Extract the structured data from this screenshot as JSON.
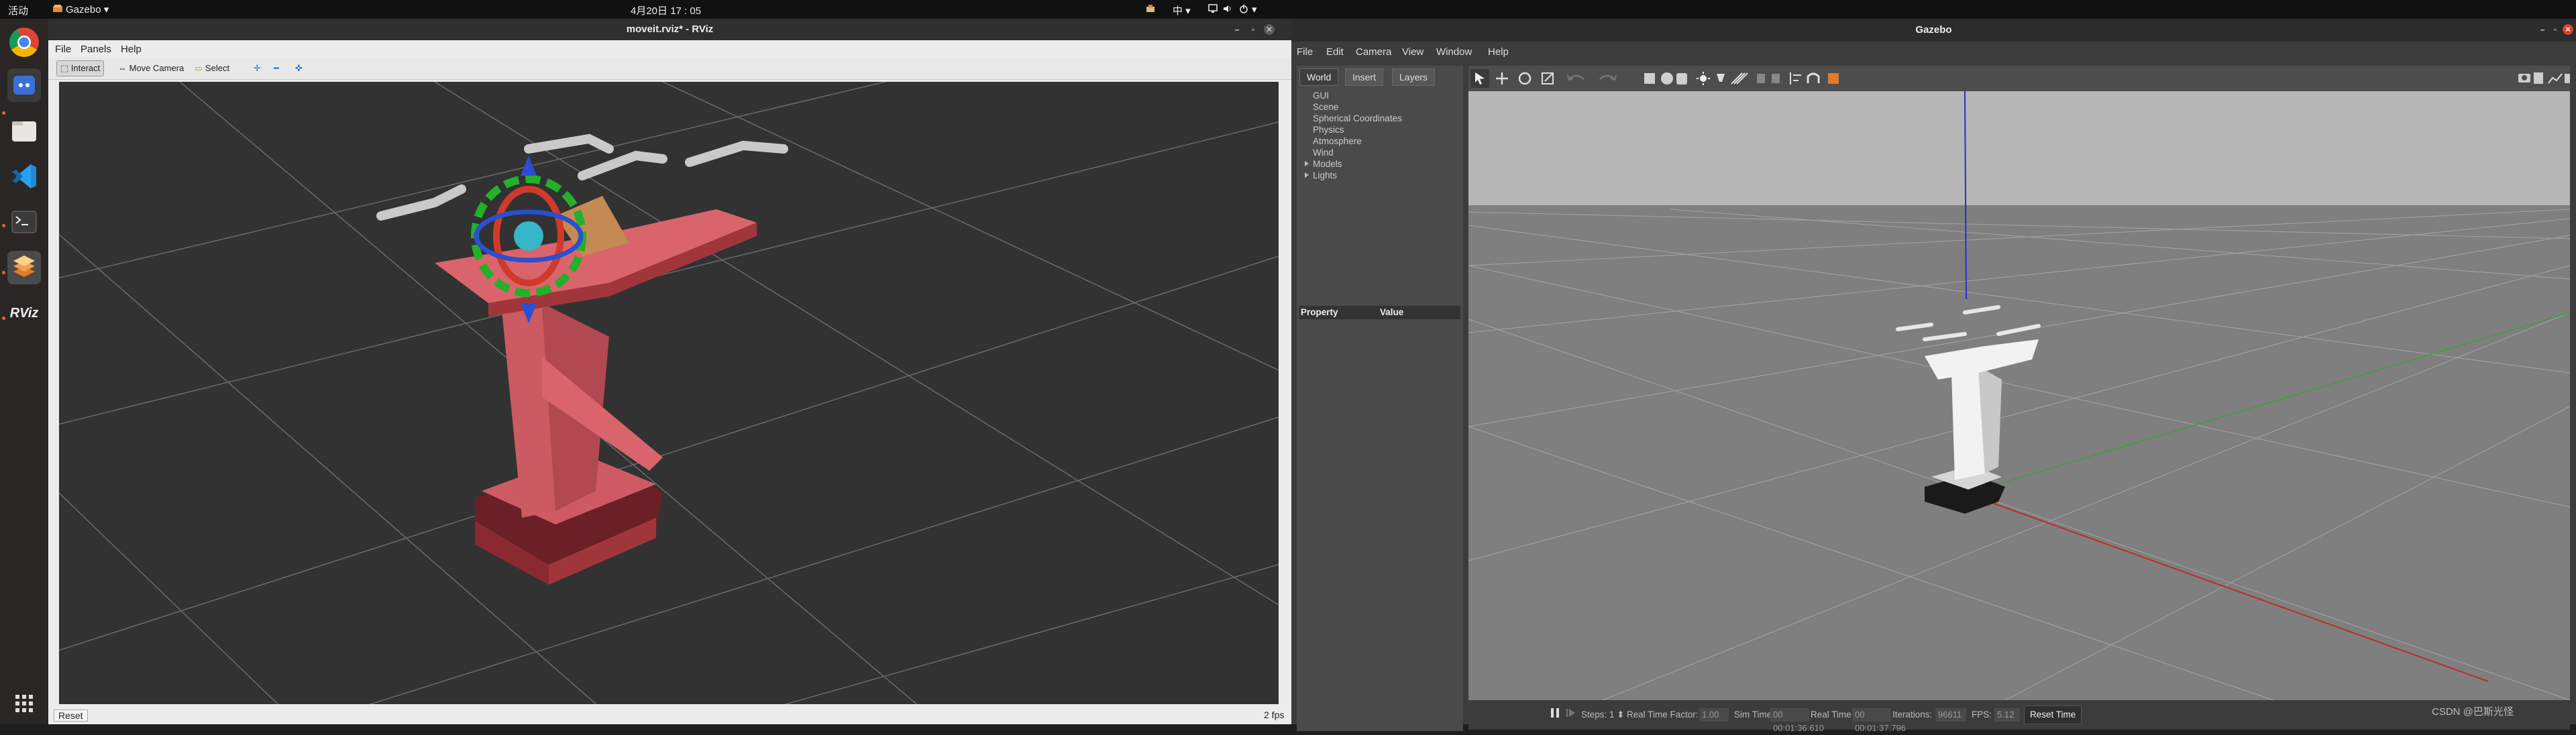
{
  "topbar": {
    "activities": "活动",
    "app_menu": "Gazebo",
    "clock": "4月20日  17 : 05",
    "input_method": "中"
  },
  "dock": {
    "items": [
      "chrome-icon",
      "files-icon",
      "vscode-icon",
      "terminal-icon",
      "stacked-app-icon",
      "rviz-icon",
      "app-grid-icon"
    ],
    "rviz_label": "RViz"
  },
  "rviz": {
    "title": "moveit.rviz* - RViz",
    "menu": [
      "File",
      "Panels",
      "Help"
    ],
    "toolbar": {
      "interact": "Interact",
      "move_camera": "Move Camera",
      "select": "Select"
    },
    "status": {
      "reset": "Reset",
      "fps": "2 fps"
    }
  },
  "gazebo": {
    "title": "Gazebo",
    "menu": [
      "File",
      "Edit",
      "Camera",
      "View",
      "Window",
      "Help"
    ],
    "tabs": [
      "World",
      "Insert",
      "Layers"
    ],
    "tree": [
      "GUI",
      "Scene",
      "Spherical Coordinates",
      "Physics",
      "Atmosphere",
      "Wind",
      "Models",
      "Lights"
    ],
    "property_header": "Property",
    "value_header": "Value",
    "bottom": {
      "steps_label": "Steps:",
      "steps_value": "1",
      "rtf_label": "Real Time Factor:",
      "rtf_value": "1.00",
      "sim_time_label": "Sim Time:",
      "sim_time_value": "00 00:01:36.610",
      "real_time_label": "Real Time:",
      "real_time_value": "00 00:01:37.796",
      "iterations_label": "Iterations:",
      "iterations_value": "96611",
      "fps_label": "FPS:",
      "fps_value": "5.12",
      "reset_time": "Reset Time"
    },
    "watermark": "CSDN @巴斯光怪"
  },
  "colors": {
    "robot_rviz": "#d9646c",
    "robot_gz": "#f2f2f2",
    "gz_sky": "#b7b7b7",
    "gz_ground": "#7f7f7f"
  }
}
